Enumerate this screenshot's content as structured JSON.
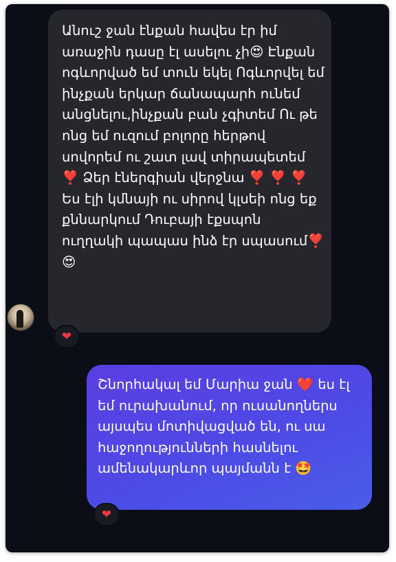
{
  "messages": [
    {
      "direction": "received",
      "text": "Անուշ ջան էնքան հավես էր իմ առաջին դասը էլ ասելու չի😍 Էնքան ոգևորված եմ տուն եկել Ոգևորվել եմ ինչքան երկար ճանապարհ ունեմ անցնելու,ինչքան բան չգիտեմ Ու թե ոնց եմ ուզում բոլորը հերթով սովորեմ ու շատ լավ տիրապետեմ ❣️ Ձեր էներգիան վերջնա ❣️ ❣️ ❣️ Ես էլի կմնայի ու սիրով կլսեի ոնց եք քննարկում Դուբայի էքսպոն ուղղակի պապաս ինձ էր սպասում❣️😍",
      "reaction": "❤"
    },
    {
      "direction": "sent",
      "text": "Շնորհակալ եմ Մարիա ջան ❤️ ես էլ եմ ուրախանում, որ ուսանողներս այսպես մոտիվացված են, ու սա հաջողությունների հասնելու ամենակարևոր պայմանն է 🤩",
      "reaction": "❤"
    }
  ],
  "colors": {
    "background": "#0b0e17",
    "received_bubble": "#26272d",
    "sent_bubble": "#4d4ae6",
    "reaction_heart": "#e53945"
  }
}
